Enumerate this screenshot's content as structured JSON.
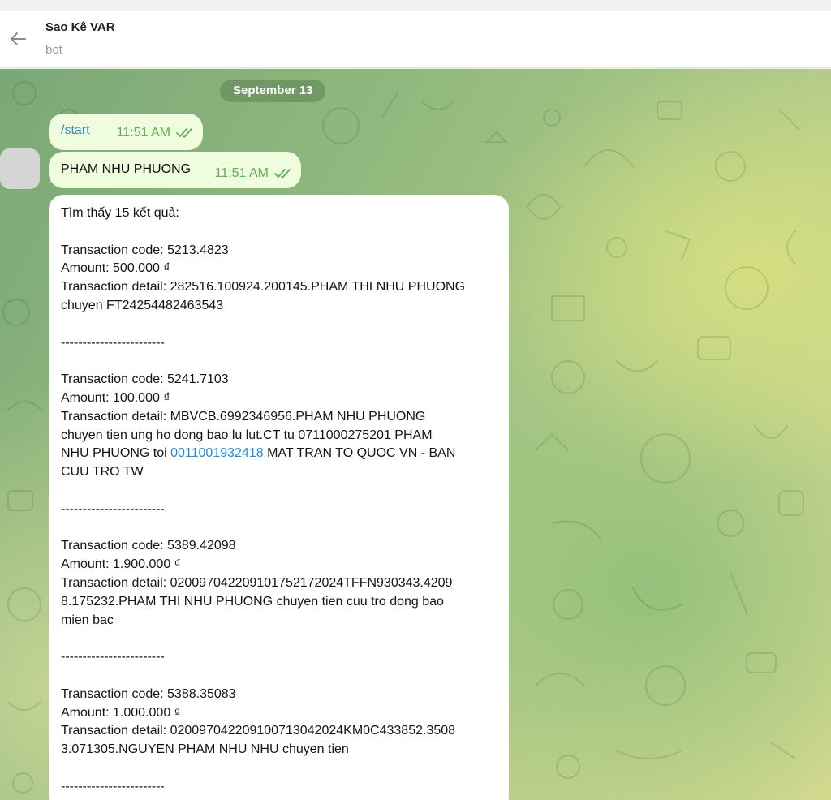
{
  "header": {
    "title": "Sao Kê VAR",
    "subtitle": "bot"
  },
  "date_separator": "September 13",
  "messages": [
    {
      "text": "/start",
      "time": "11:51 AM",
      "status": "read-double-check"
    },
    {
      "text": "PHAM NHU PHUONG",
      "time": "11:51 AM",
      "status": "read-double-check"
    }
  ],
  "result": {
    "summary": "Tìm thấy 15 kết quả:",
    "separator": "------------------------",
    "tx": [
      {
        "code": "Transaction code: 5213.4823",
        "amount": "Amount: 500.000 ₫",
        "detail_lines": [
          "Transaction detail: 282516.100924.200145.PHAM THI NHU PHUONG",
          "chuyen FT24254482463543"
        ]
      },
      {
        "code": "Transaction code: 5241.7103",
        "amount": "Amount: 100.000 ₫",
        "detail_lines": [
          "Transaction detail: MBVCB.6992346956.PHAM NHU PHUONG",
          "chuyen tien ung ho dong bao lu lut.CT tu 0711000275201 PHAM"
        ],
        "detail_line3_pre": "NHU PHUONG toi ",
        "detail_link": "0011001932418",
        "detail_line3_post": " MAT TRAN TO QUOC VN - BAN",
        "detail_line4": "CUU TRO TW"
      },
      {
        "code": "Transaction code: 5389.42098",
        "amount": "Amount: 1.900.000 ₫",
        "detail_lines": [
          "Transaction detail: 0200970422091017521720​24TFFN930343.4209",
          "8.175232.PHAM THI NHU PHUONG chuyen tien cuu tro dong bao",
          "mien bac"
        ]
      },
      {
        "code": "Transaction code: 5388.35083",
        "amount": "Amount: 1.000.000 ₫",
        "detail_lines": [
          "Transaction detail: 020097042209100713042024KM0C433852.3508",
          "3.071305.NGUYEN PHAM NHU NHU chuyen tien"
        ]
      }
    ]
  },
  "colors": {
    "outgoing_bubble": "#effdde",
    "incoming_bubble": "#ffffff",
    "time_green": "#5fae5a",
    "link_blue": "#2a8bd0"
  },
  "icons": [
    "back-arrow-icon",
    "double-check-icon"
  ]
}
